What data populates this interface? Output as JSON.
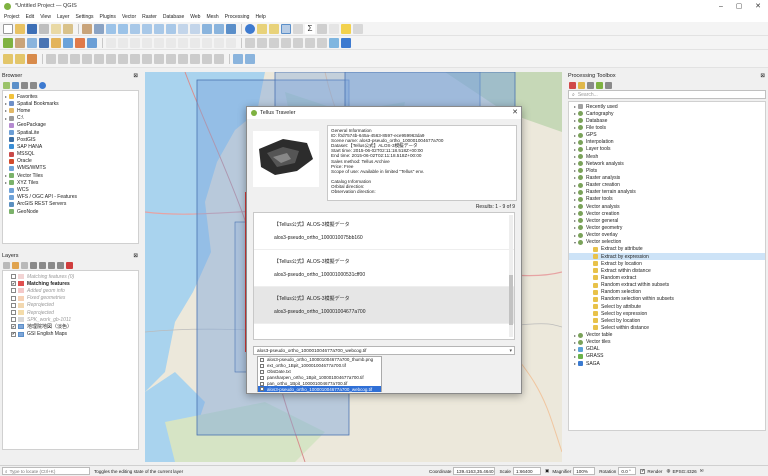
{
  "window": {
    "title": "*Untitled Project — QGIS"
  },
  "menubar": [
    "Project",
    "Edit",
    "View",
    "Layer",
    "Settings",
    "Plugins",
    "Vector",
    "Raster",
    "Database",
    "Web",
    "Mesh",
    "Processing",
    "Help"
  ],
  "browser": {
    "title": "Browser",
    "items": [
      {
        "label": "Favorites",
        "icon": "star-icon",
        "arrow": "▸"
      },
      {
        "label": "Spatial Bookmarks",
        "icon": "bookmark-icon",
        "arrow": "▸"
      },
      {
        "label": "Home",
        "icon": "home-folder-icon",
        "arrow": "▸"
      },
      {
        "label": "C:\\",
        "icon": "drive-icon",
        "arrow": "▸"
      },
      {
        "label": "GeoPackage",
        "icon": "geopackage-icon",
        "arrow": ""
      },
      {
        "label": "SpatiaLite",
        "icon": "spatialite-icon",
        "arrow": ""
      },
      {
        "label": "PostGIS",
        "icon": "postgis-icon",
        "arrow": ""
      },
      {
        "label": "SAP HANA",
        "icon": "sap-hana-icon",
        "arrow": ""
      },
      {
        "label": "MSSQL",
        "icon": "mssql-icon",
        "arrow": ""
      },
      {
        "label": "Oracle",
        "icon": "oracle-icon",
        "arrow": ""
      },
      {
        "label": "WMS/WMTS",
        "icon": "wms-icon",
        "arrow": ""
      },
      {
        "label": "Vector Tiles",
        "icon": "vector-tiles-icon",
        "arrow": "▸"
      },
      {
        "label": "XYZ Tiles",
        "icon": "xyz-tiles-icon",
        "arrow": "▸"
      },
      {
        "label": "WCS",
        "icon": "wcs-icon",
        "arrow": ""
      },
      {
        "label": "WFS / OGC API - Features",
        "icon": "wfs-icon",
        "arrow": ""
      },
      {
        "label": "ArcGIS REST Servers",
        "icon": "arcgis-icon",
        "arrow": ""
      },
      {
        "label": "GeoNode",
        "icon": "geonode-icon",
        "arrow": ""
      }
    ]
  },
  "layers": {
    "title": "Layers",
    "items": [
      {
        "label": "Matching features (0)",
        "checked": false,
        "color": "#f2d4d4",
        "muted": true,
        "bold": false
      },
      {
        "label": "Matching features",
        "checked": true,
        "color": "#e05050",
        "muted": false,
        "bold": true
      },
      {
        "label": "Added geom info",
        "checked": false,
        "color": "#f4c8c8",
        "muted": true,
        "bold": false
      },
      {
        "label": "Fixed geometries",
        "checked": false,
        "color": "#f7d2b6",
        "muted": true,
        "bold": false
      },
      {
        "label": "Reprojected",
        "checked": false,
        "color": "#f2d8b0",
        "muted": true,
        "bold": false
      },
      {
        "label": "Reprojected",
        "checked": false,
        "color": "#f4dcaa",
        "muted": true,
        "bold": false
      },
      {
        "label": "SPK_work_gb-1011",
        "checked": false,
        "color": "#d8d8d8",
        "muted": true,
        "bold": false
      },
      {
        "label": "地理院地図（淡色）",
        "checked": true,
        "color": "#7fa6d8",
        "muted": false,
        "bold": false
      },
      {
        "label": "GSI English Maps",
        "checked": true,
        "color": "#7fa6d8",
        "muted": false,
        "bold": false
      }
    ]
  },
  "toolbox": {
    "title": "Processing Toolbox",
    "search_placeholder": "Search...",
    "items": [
      {
        "label": "Recently used",
        "icon": "clock-icon",
        "indent": 0,
        "arrow": "▸",
        "sel": false
      },
      {
        "label": "Cartography",
        "icon": "gear-icon",
        "indent": 0,
        "arrow": "▸",
        "sel": false
      },
      {
        "label": "Database",
        "icon": "gear-icon",
        "indent": 0,
        "arrow": "▸",
        "sel": false
      },
      {
        "label": "File tools",
        "icon": "gear-icon",
        "indent": 0,
        "arrow": "▸",
        "sel": false
      },
      {
        "label": "GPS",
        "icon": "gear-icon",
        "indent": 0,
        "arrow": "▸",
        "sel": false
      },
      {
        "label": "Interpolation",
        "icon": "gear-icon",
        "indent": 0,
        "arrow": "▸",
        "sel": false
      },
      {
        "label": "Layer tools",
        "icon": "gear-icon",
        "indent": 0,
        "arrow": "▸",
        "sel": false
      },
      {
        "label": "Mesh",
        "icon": "gear-icon",
        "indent": 0,
        "arrow": "▸",
        "sel": false
      },
      {
        "label": "Network analysis",
        "icon": "gear-icon",
        "indent": 0,
        "arrow": "▸",
        "sel": false
      },
      {
        "label": "Plots",
        "icon": "gear-icon",
        "indent": 0,
        "arrow": "▸",
        "sel": false
      },
      {
        "label": "Raster analysis",
        "icon": "gear-icon",
        "indent": 0,
        "arrow": "▸",
        "sel": false
      },
      {
        "label": "Raster creation",
        "icon": "gear-icon",
        "indent": 0,
        "arrow": "▸",
        "sel": false
      },
      {
        "label": "Raster terrain analysis",
        "icon": "gear-icon",
        "indent": 0,
        "arrow": "▸",
        "sel": false
      },
      {
        "label": "Raster tools",
        "icon": "gear-icon",
        "indent": 0,
        "arrow": "▸",
        "sel": false
      },
      {
        "label": "Vector analysis",
        "icon": "gear-icon",
        "indent": 0,
        "arrow": "▸",
        "sel": false
      },
      {
        "label": "Vector creation",
        "icon": "gear-icon",
        "indent": 0,
        "arrow": "▸",
        "sel": false
      },
      {
        "label": "Vector general",
        "icon": "gear-icon",
        "indent": 0,
        "arrow": "▸",
        "sel": false
      },
      {
        "label": "Vector geometry",
        "icon": "gear-icon",
        "indent": 0,
        "arrow": "▸",
        "sel": false
      },
      {
        "label": "Vector overlay",
        "icon": "gear-icon",
        "indent": 0,
        "arrow": "▸",
        "sel": false
      },
      {
        "label": "Vector selection",
        "icon": "gear-icon",
        "indent": 0,
        "arrow": "▾",
        "sel": false
      },
      {
        "label": "Extract by attribute",
        "icon": "algorithm-icon",
        "indent": 1,
        "arrow": "",
        "sel": false
      },
      {
        "label": "Extract by expression",
        "icon": "algorithm-icon",
        "indent": 1,
        "arrow": "",
        "sel": true
      },
      {
        "label": "Extract by location",
        "icon": "algorithm-icon",
        "indent": 1,
        "arrow": "",
        "sel": false
      },
      {
        "label": "Extract within distance",
        "icon": "algorithm-icon",
        "indent": 1,
        "arrow": "",
        "sel": false
      },
      {
        "label": "Random extract",
        "icon": "algorithm-icon",
        "indent": 1,
        "arrow": "",
        "sel": false
      },
      {
        "label": "Random extract within subsets",
        "icon": "algorithm-icon",
        "indent": 1,
        "arrow": "",
        "sel": false
      },
      {
        "label": "Random selection",
        "icon": "algorithm-icon",
        "indent": 1,
        "arrow": "",
        "sel": false
      },
      {
        "label": "Random selection within subsets",
        "icon": "algorithm-icon",
        "indent": 1,
        "arrow": "",
        "sel": false
      },
      {
        "label": "Select by attribute",
        "icon": "algorithm-icon",
        "indent": 1,
        "arrow": "",
        "sel": false
      },
      {
        "label": "Select by expression",
        "icon": "algorithm-icon",
        "indent": 1,
        "arrow": "",
        "sel": false
      },
      {
        "label": "Select by location",
        "icon": "algorithm-icon",
        "indent": 1,
        "arrow": "",
        "sel": false
      },
      {
        "label": "Select within distance",
        "icon": "algorithm-icon",
        "indent": 1,
        "arrow": "",
        "sel": false
      },
      {
        "label": "Vector table",
        "icon": "gear-icon",
        "indent": 0,
        "arrow": "▸",
        "sel": false
      },
      {
        "label": "Vector tiles",
        "icon": "gear-icon",
        "indent": 0,
        "arrow": "▸",
        "sel": false
      },
      {
        "label": "GDAL",
        "icon": "gdal-icon",
        "indent": 0,
        "arrow": "▸",
        "sel": false
      },
      {
        "label": "GRASS",
        "icon": "grass-icon",
        "indent": 0,
        "arrow": "▸",
        "sel": false
      },
      {
        "label": "SAGA",
        "icon": "saga-icon",
        "indent": 0,
        "arrow": "▸",
        "sel": false
      }
    ]
  },
  "dialog": {
    "title": "Tellus Traveler",
    "info_lines": [
      "General Information",
      "ID: f0d7574b-645a-4563-8597-ece959963da9",
      "Scene name: alos3-pseudo_ortho_100001004677a700",
      "Dataset:【Tellus公式】ALOS-3模擬データ",
      "Start time: 2015-06-02T02:11:18.518Z+00:00",
      "End time: 2015-06-02T02:11:18.518Z+00:00",
      "Sales method: Tellus Archive",
      "Price: Free",
      "Scope of use: Available in limited \"Tellus\" env.",
      "",
      "Catalog Information",
      "Orbital direction: ",
      "Observation direction: "
    ],
    "results_label": "Results: 1 - 9 of 9",
    "list_items": [
      {
        "dataset": "【Tellus公式】ALOS-3模擬データ",
        "scene": "alos3-pseudo_ortho_1000010075bb160"
      },
      {
        "dataset": "【Tellus公式】ALOS-3模擬データ",
        "scene": "alos3-pseudo_ortho_100001000531cff00"
      },
      {
        "dataset": "【Tellus公式】ALOS-3模擬データ",
        "scene": "alos3-pseudo_ortho_100001004677a700"
      }
    ],
    "combo_value": "alos3-pseudo_ortho_100001004677a700_webcog.tif",
    "files": [
      {
        "name": "alos3-pseudo_ortho_100001004677a700_thumb.png",
        "sel": false
      },
      {
        "name": "ext_ortho_1Bpit_100001004677a700.tif",
        "sel": false
      },
      {
        "name": "ObsDate.txt",
        "sel": false
      },
      {
        "name": "pansharpen_ortho_1Bpit_100001004677a700.tif",
        "sel": false
      },
      {
        "name": "pan_ortho_1Bpit_100001004677a700.tif",
        "sel": false
      },
      {
        "name": "alos3-pseudo_ortho_100001004677a700_webcog.tif",
        "sel": true
      }
    ]
  },
  "statusbar": {
    "locate_placeholder": "Type to locate (Ctrl+K)",
    "message": "Toggles the editing state of the current layer",
    "coordinate_label": "Coordinate",
    "coordinate_value": "139.4163,35.4640",
    "scale_label": "Scale",
    "scale_value": "1:66400",
    "magnifier_label": "Magnifier",
    "magnifier_value": "100%",
    "rotation_label": "Rotation",
    "rotation_value": "0.0 °",
    "render_label": "Render",
    "crs_label": "EPSG:4326"
  },
  "colors": {
    "accent": "#2f6fd6",
    "selection": "#cde3f7",
    "map_tile": "#7aa3dc"
  }
}
